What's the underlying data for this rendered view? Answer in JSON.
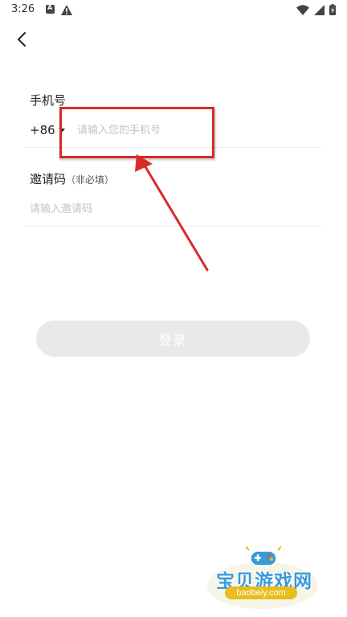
{
  "status_bar": {
    "time": "3:26"
  },
  "icons": {
    "back": "chevron-left-icon",
    "wifi": "wifi-icon",
    "signal": "signal-icon",
    "battery": "battery-charging-icon",
    "notification": "a-notification-icon",
    "warning": "warning-icon"
  },
  "form": {
    "phone_label": "手机号",
    "country_code": "+86",
    "phone_placeholder": "请输入您的手机号",
    "invite_label": "邀请码",
    "invite_hint": "（非必填）",
    "invite_placeholder": "请输入邀请码",
    "login_label": "登录"
  },
  "watermark": {
    "title": "宝贝游戏网",
    "url": "baobeiy.com"
  },
  "colors": {
    "annotation_red": "#d92a2a",
    "button_disabled_bg": "#e9e9e9",
    "placeholder": "#c3c3c3",
    "watermark_blue": "#3a9ad9",
    "watermark_gold": "#e9bd1d"
  }
}
